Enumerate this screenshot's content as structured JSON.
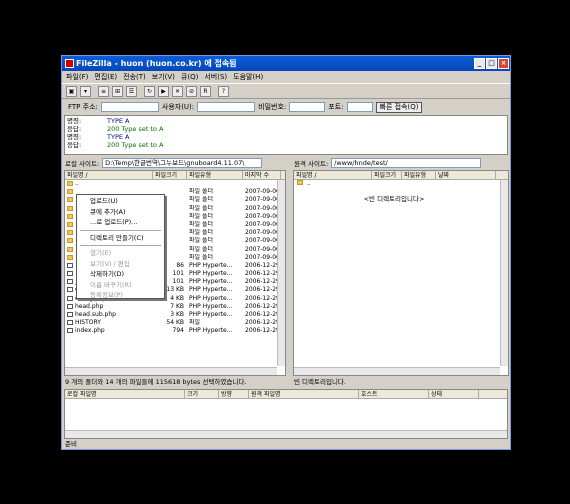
{
  "window": {
    "title": "FileZilla - huon (huon.co.kr) 에 접속됨"
  },
  "menu": [
    "파일(F)",
    "편집(E)",
    "전송(T)",
    "보기(V)",
    "큐(Q)",
    "서버(S)",
    "도움말(H)"
  ],
  "toolbar_icons": [
    "site-manager-icon",
    "dropdown-icon",
    "toggle-log-icon",
    "toggle-tree-icon",
    "queue-icon",
    "refresh-icon",
    "process-queue-icon",
    "cancel-icon",
    "disconnect-icon",
    "reconnect-icon",
    "help-icon"
  ],
  "quickconnect": {
    "host_label": "FTP 주소:",
    "user_label": "사용자(U):",
    "pass_label": "비밀번호:",
    "port_label": "포트:",
    "button": "빠른 접속(Q)"
  },
  "log": [
    {
      "k": "명령:",
      "t": "TYPE A",
      "c": "cmd"
    },
    {
      "k": "응답:",
      "t": "200 Type set to A",
      "c": "rsp"
    },
    {
      "k": "명령:",
      "t": "TYPE A",
      "c": "cmd"
    },
    {
      "k": "응답:",
      "t": "200 Type set to A",
      "c": "rsp"
    }
  ],
  "local": {
    "path_label": "로컬 사이트:",
    "path": "D:\\Temp\\한글번역\\그누보드\\gnuboard4.11.07\\",
    "columns": [
      "파일명 /",
      "파일크기",
      "파일유형",
      "마지막 수"
    ],
    "rows": [
      {
        "name": "..",
        "size": "",
        "type": "",
        "date": "",
        "icon": "folder"
      },
      {
        "name": "",
        "size": "",
        "type": "파일 폴더",
        "date": "2007-09-06",
        "icon": "folder"
      },
      {
        "name": "",
        "size": "",
        "type": "파일 폴더",
        "date": "2007-09-06",
        "icon": "folder"
      },
      {
        "name": "",
        "size": "",
        "type": "파일 폴더",
        "date": "2007-09-06",
        "icon": "folder"
      },
      {
        "name": "",
        "size": "",
        "type": "파일 폴더",
        "date": "2007-09-06",
        "icon": "folder"
      },
      {
        "name": "",
        "size": "",
        "type": "파일 폴더",
        "date": "2007-09-06",
        "icon": "folder"
      },
      {
        "name": "",
        "size": "",
        "type": "파일 폴더",
        "date": "2007-09-06",
        "icon": "folder"
      },
      {
        "name": "",
        "size": "",
        "type": "파일 폴더",
        "date": "2007-09-06",
        "icon": "folder"
      },
      {
        "name": "",
        "size": "",
        "type": "파일 폴더",
        "date": "2007-09-06",
        "icon": "folder"
      },
      {
        "name": "",
        "size": "",
        "type": "파일 폴더",
        "date": "2007-09-06",
        "icon": "folder"
      },
      {
        "name": "",
        "size": "86",
        "type": "PHP Hyperte...",
        "date": "2006-12-29",
        "icon": "file"
      },
      {
        "name": "",
        "size": "101",
        "type": "PHP Hyperte...",
        "date": "2006-12-29",
        "icon": "file"
      },
      {
        "name": "_tail.php",
        "size": "101",
        "type": "PHP Hyperte...",
        "date": "2006-12-29",
        "icon": "file"
      },
      {
        "name": "common.php",
        "size": "13 KB",
        "type": "PHP Hyperte...",
        "date": "2006-12-29",
        "icon": "file"
      },
      {
        "name": "config.php",
        "size": "4 KB",
        "type": "PHP Hyperte...",
        "date": "2006-12-29",
        "icon": "file"
      },
      {
        "name": "head.php",
        "size": "7 KB",
        "type": "PHP Hyperte...",
        "date": "2006-12-29",
        "icon": "file"
      },
      {
        "name": "head.sub.php",
        "size": "3 KB",
        "type": "PHP Hyperte...",
        "date": "2006-12-29",
        "icon": "file"
      },
      {
        "name": "HISTORY",
        "size": "54 KB",
        "type": "파일",
        "date": "2006-12-29",
        "icon": "file"
      },
      {
        "name": "index.php",
        "size": "794",
        "type": "PHP Hyperte...",
        "date": "2006-12-29",
        "icon": "file"
      }
    ],
    "status": "9 개의 폴더와 14 개의 파일들에 115618 bytes 선택하였습니다."
  },
  "remote": {
    "path_label": "원격 사이트:",
    "path": "/www/hnde/test/",
    "columns": [
      "파일명 /",
      "파일크기",
      "파일유형",
      "날짜"
    ],
    "rows": [
      {
        "name": "..",
        "icon": "folder"
      }
    ],
    "empty_text": "<빈 디렉토리입니다>",
    "status": "빈 디렉토리입니다."
  },
  "context_menu": {
    "items": [
      {
        "label": "업로드(U)",
        "disabled": false
      },
      {
        "label": "큐에 추가(A)",
        "disabled": false
      },
      {
        "label": "...로 업로드(P)...",
        "disabled": false
      },
      {
        "sep": true
      },
      {
        "label": "디렉토리 만들기(C)",
        "disabled": false
      },
      {
        "sep": true
      },
      {
        "label": "열기(E)",
        "disabled": true
      },
      {
        "label": "보기(V) / 편집",
        "disabled": true
      },
      {
        "label": "삭제하기(D)",
        "disabled": false
      },
      {
        "label": "이름 바꾸기(R)",
        "disabled": true
      },
      {
        "label": "등록정보(P)",
        "disabled": true
      }
    ]
  },
  "queue": {
    "columns": [
      "로컬 파일명",
      "크기",
      "방향",
      "원격 파일명",
      "호스트",
      "상태"
    ]
  },
  "statusbar": {
    "text": "준비"
  }
}
